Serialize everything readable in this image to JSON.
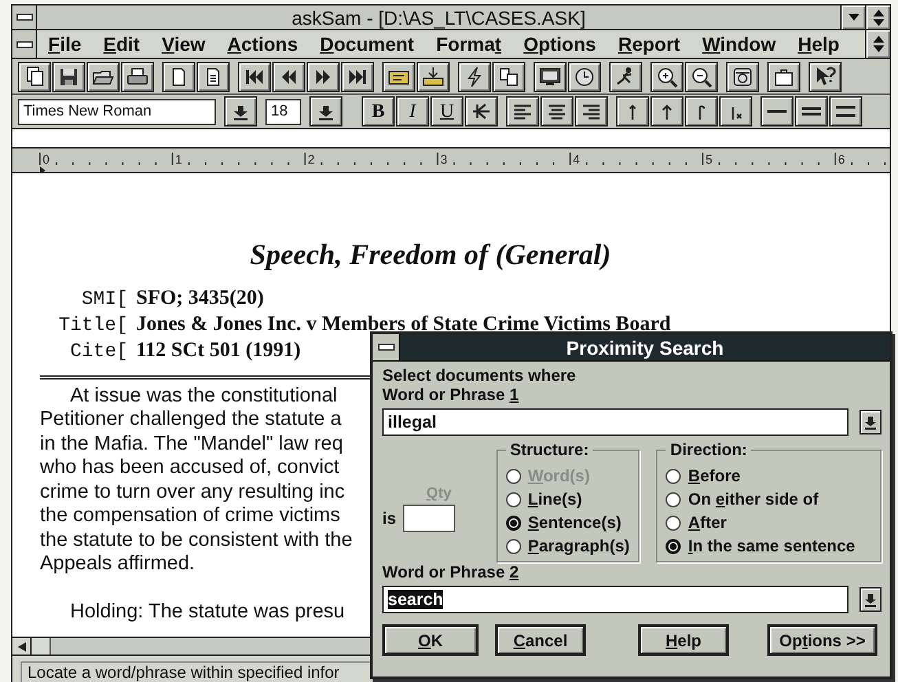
{
  "window": {
    "title": "askSam - [D:\\AS_LT\\CASES.ASK]"
  },
  "menu": [
    {
      "key": "F",
      "post": "ile"
    },
    {
      "key": "E",
      "post": "dit"
    },
    {
      "key": "V",
      "post": "iew"
    },
    {
      "key": "A",
      "post": "ctions"
    },
    {
      "key": "D",
      "post": "ocument"
    },
    {
      "pre": "Forma",
      "key": "t"
    },
    {
      "key": "O",
      "post": "ptions"
    },
    {
      "key": "R",
      "post": "eport"
    },
    {
      "key": "W",
      "post": "indow"
    },
    {
      "key": "H",
      "post": "elp"
    }
  ],
  "format_bar": {
    "font": "Times New Roman",
    "size": "18",
    "styles": [
      "B",
      "I",
      "U"
    ]
  },
  "ruler": {
    "labels": [
      "0",
      "1",
      "2",
      "3",
      "4",
      "5",
      "6"
    ]
  },
  "document": {
    "heading": "Speech, Freedom of (General)",
    "fields": [
      {
        "label": "SMI[",
        "value": "SFO; 3435(20)"
      },
      {
        "label": "Title[",
        "value": "Jones & Jones Inc. v Members of State Crime Victims Board"
      },
      {
        "label": "Cite[",
        "value": "112 SCt 501 (1991)"
      }
    ],
    "paragraphs": [
      {
        "lines": [
          "At issue was the constitutional",
          "Petitioner challenged the statute a",
          "in the Mafia. The \"Mandel\" law req",
          "who has been accused of, convict",
          "crime to turn over any resulting inc",
          "the compensation of crime victims",
          "the statute to be consistent with the",
          "Appeals affirmed."
        ]
      },
      {
        "lines": [
          "Holding: The statute was presu"
        ]
      }
    ]
  },
  "status_bar": "Locate a word/phrase within specified infor",
  "dialog": {
    "title": "Proximity Search",
    "intro": "Select documents where",
    "phrase_1": {
      "label": {
        "pre": "Word or Phrase ",
        "key": "1"
      },
      "value": "illegal",
      "selected": false
    },
    "qty": {
      "label": {
        "key": "Q",
        "post": "ty"
      },
      "prefix": "is",
      "disabled": true
    },
    "structure": {
      "title": "Structure:",
      "options": [
        {
          "key": "W",
          "post": "ord(s)",
          "selected": false,
          "disabled": true
        },
        {
          "key": "L",
          "post": "ine(s)",
          "selected": false,
          "disabled": false
        },
        {
          "key": "S",
          "post": "entence(s)",
          "selected": true,
          "disabled": false
        },
        {
          "key": "P",
          "post": "aragraph(s)",
          "selected": false,
          "disabled": false
        }
      ]
    },
    "direction": {
      "title": "Direction:",
      "options": [
        {
          "key": "B",
          "post": "efore",
          "selected": false
        },
        {
          "pre": "On ",
          "key": "e",
          "post": "ither side of",
          "selected": false
        },
        {
          "key": "A",
          "post": "fter",
          "selected": false
        },
        {
          "key": "I",
          "post": "n the same sentence",
          "selected": true
        }
      ]
    },
    "phrase_2": {
      "label": {
        "pre": "Word or Phrase ",
        "key": "2"
      },
      "value": "search",
      "selected": true
    },
    "buttons": [
      {
        "key": "O",
        "post": "K"
      },
      {
        "key": "C",
        "post": "ancel"
      },
      {
        "key": "H",
        "post": "elp"
      },
      {
        "pre": "Op",
        "key": "t",
        "post": "ions >>"
      }
    ]
  }
}
